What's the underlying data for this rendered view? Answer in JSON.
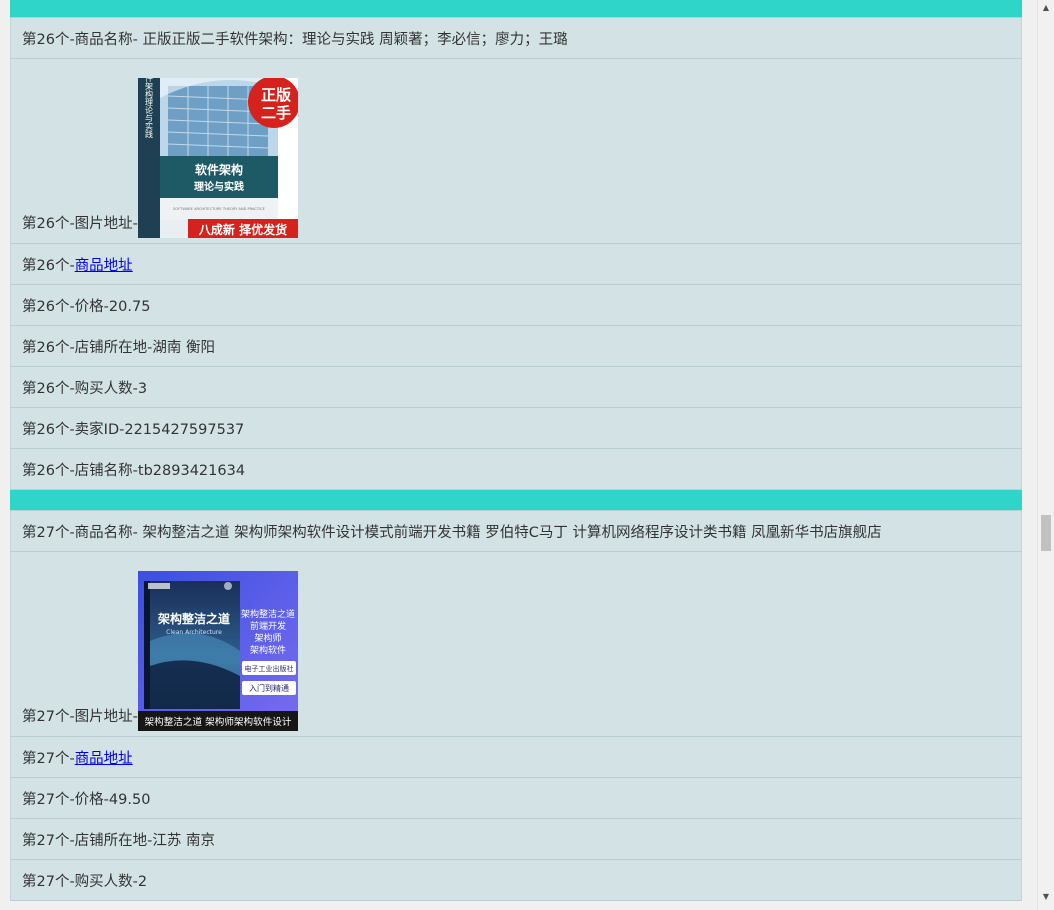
{
  "items": [
    {
      "name_label": "第26个-商品名称- 正版正版二手软件架构：理论与实践 周颖著；李必信；廖力；王璐",
      "image_label": "第26个-图片地址-",
      "image_cover": {
        "badge_top": "正版",
        "badge_bottom": "二手",
        "spine": "软件架构理论与实践",
        "title_1": "软件架构",
        "title_2": "理论与实践",
        "english": "SOFTWARE ARCHITECTURE THEORY AND PRACTICE",
        "banner": "八成新 择优发货"
      },
      "link_prefix": "第26个-",
      "link_text": "商品地址",
      "price_label": "第26个-价格-20.75",
      "location_label": "第26个-店铺所在地-湖南 衡阳",
      "buyers_label": "第26个-购买人数-3",
      "seller_label": "第26个-卖家ID-2215427597537",
      "shop_label": "第26个-店铺名称-tb2893421634"
    },
    {
      "name_label": "第27个-商品名称- 架构整洁之道 架构师架构软件设计模式前端开发书籍 罗伯特C马丁 计算机网络程序设计类书籍 凤凰新华书店旗舰店",
      "image_label": "第27个-图片地址-",
      "image_cover": {
        "title": "架构整洁之道",
        "subtitle": "Clean Architecture",
        "side_1": "架构整洁之道",
        "side_2": "前端开发",
        "side_3": "架构师",
        "side_4": "架构软件",
        "publisher": "电子工业出版社",
        "tag": "入门到精通",
        "banner": "架构整洁之道 架构师架构软件设计"
      },
      "link_prefix": "第27个-",
      "link_text": "商品地址",
      "price_label": "第27个-价格-49.50",
      "location_label": "第27个-店铺所在地-江苏 南京",
      "buyers_label": "第27个-购买人数-2"
    }
  ],
  "scrollbar": {
    "up_arrow": "▲",
    "down_arrow": "▼"
  },
  "colors": {
    "separator": "#2fd5c9",
    "row_bg": "#d3e3e5",
    "link": "#0000ee"
  }
}
